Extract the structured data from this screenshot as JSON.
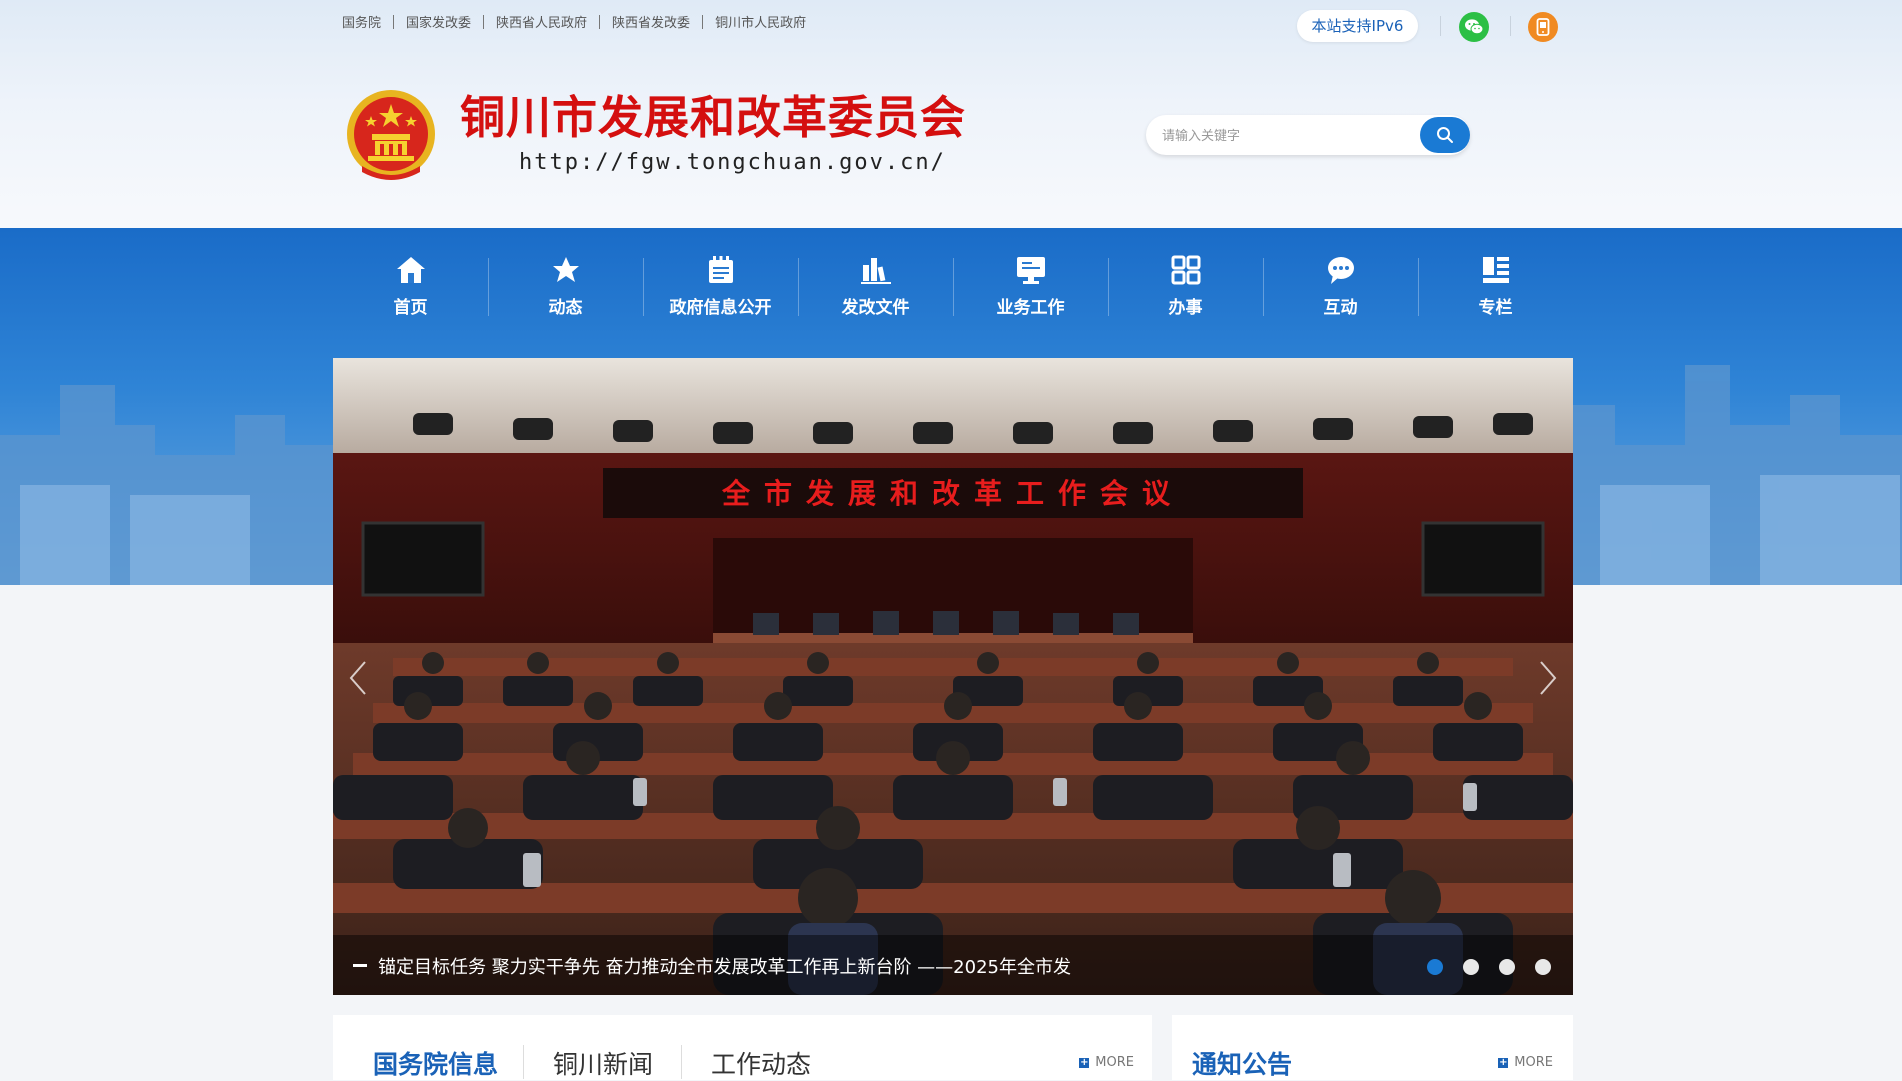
{
  "top_links": [
    "国务院",
    "国家发改委",
    "陕西省人民政府",
    "陕西省发改委",
    "铜川市人民政府"
  ],
  "ipv6_label": "本站支持IPv6",
  "site": {
    "title": "铜川市发展和改革委员会",
    "url": "http://fgw.tongchuan.gov.cn/"
  },
  "search": {
    "placeholder": "请输入关键字"
  },
  "nav": [
    {
      "label": "首页",
      "icon": "home-icon"
    },
    {
      "label": "动态",
      "icon": "star-icon"
    },
    {
      "label": "政府信息公开",
      "icon": "notepad-icon"
    },
    {
      "label": "发改文件",
      "icon": "books-icon"
    },
    {
      "label": "业务工作",
      "icon": "monitor-icon"
    },
    {
      "label": "办事",
      "icon": "grid-icon"
    },
    {
      "label": "互动",
      "icon": "chat-icon"
    },
    {
      "label": "专栏",
      "icon": "column-icon"
    }
  ],
  "banner": {
    "meeting_banner_text": "全市发展和改革工作会议",
    "caption": "锚定目标任务 聚力实干争先 奋力推动全市发展改革工作再上新台阶 ——2025年全市发",
    "slide_count": 4,
    "active_slide": 1
  },
  "panels": {
    "left_tabs": [
      "国务院信息",
      "铜川新闻",
      "工作动态"
    ],
    "right_title": "通知公告",
    "more_label": "MORE"
  },
  "colors": {
    "title_red": "#d40f0f",
    "primary_blue": "#1a7ad4",
    "nav_band_blue": "#1a6cc8"
  }
}
